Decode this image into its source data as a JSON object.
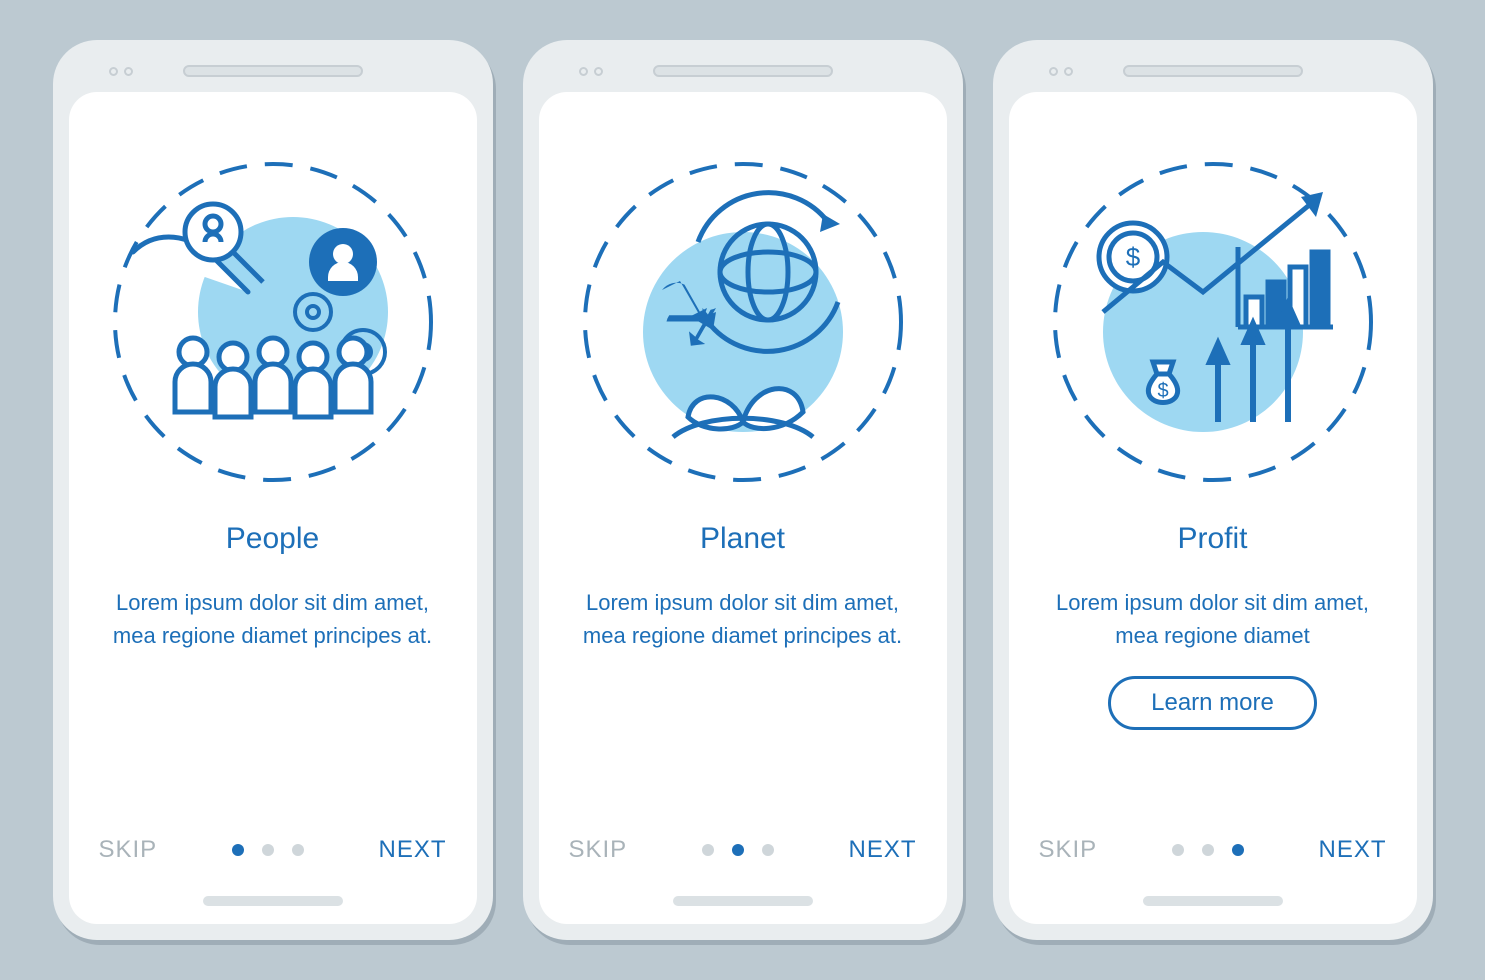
{
  "colors": {
    "primary": "#1d6fb8",
    "accent": "#6bc3eb",
    "muted": "#a9b3b9"
  },
  "screens": [
    {
      "title": "People",
      "description": "Lorem ipsum dolor sit dim amet, mea regione diamet principes at.",
      "skip": "SKIP",
      "next": "NEXT",
      "activeDot": 0,
      "illustration": "people-icon",
      "learnMore": null
    },
    {
      "title": "Planet",
      "description": "Lorem ipsum dolor sit dim amet, mea regione diamet principes at.",
      "skip": "SKIP",
      "next": "NEXT",
      "activeDot": 1,
      "illustration": "planet-icon",
      "learnMore": null
    },
    {
      "title": "Profit",
      "description": "Lorem ipsum dolor sit dim amet, mea regione diamet",
      "skip": "SKIP",
      "next": "NEXT",
      "activeDot": 2,
      "illustration": "profit-icon",
      "learnMore": "Learn more"
    }
  ]
}
